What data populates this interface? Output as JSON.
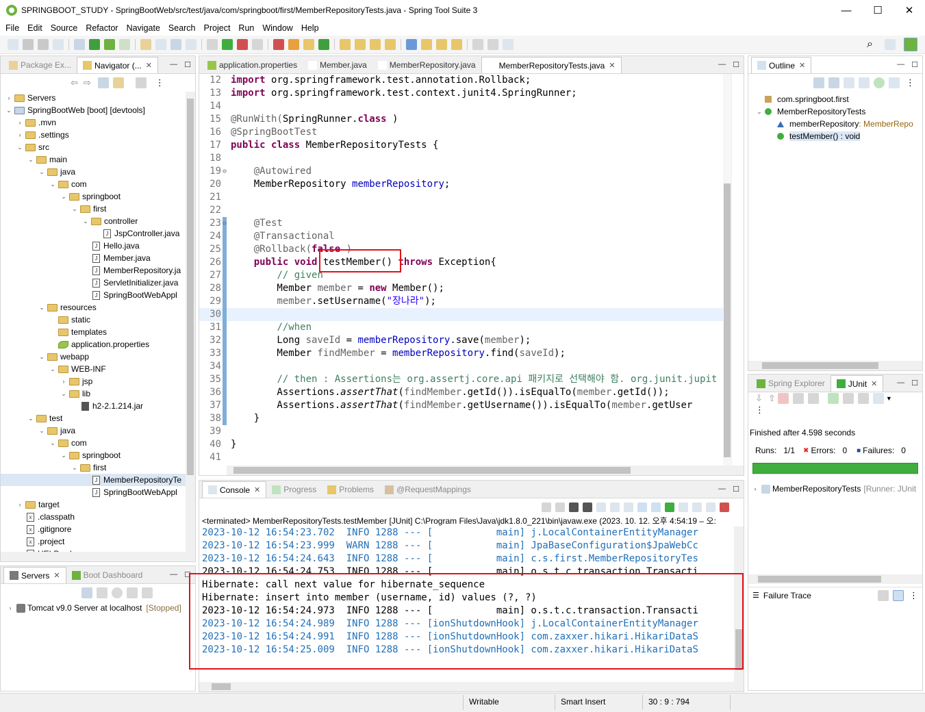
{
  "window": {
    "title": "SPRINGBOOT_STUDY - SpringBootWeb/src/test/java/com/springboot/first/MemberRepositoryTests.java - Spring Tool Suite 3",
    "minimize": "—",
    "maximize": "☐",
    "close": "✕"
  },
  "menu": [
    "File",
    "Edit",
    "Source",
    "Refactor",
    "Navigate",
    "Search",
    "Project",
    "Run",
    "Window",
    "Help"
  ],
  "explorer": {
    "tabs": [
      {
        "label": "Package Ex..."
      },
      {
        "label": "Navigator (..."
      }
    ],
    "rows": [
      {
        "d": 0,
        "t": "›",
        "k": "s",
        "label": "Servers"
      },
      {
        "d": 0,
        "t": "⌄",
        "k": "p",
        "label": "SpringBootWeb [boot] [devtools]"
      },
      {
        "d": 1,
        "t": "›",
        "k": "f",
        "label": ".mvn"
      },
      {
        "d": 1,
        "t": "›",
        "k": "f",
        "label": ".settings"
      },
      {
        "d": 1,
        "t": "⌄",
        "k": "f",
        "label": "src"
      },
      {
        "d": 2,
        "t": "⌄",
        "k": "f",
        "label": "main"
      },
      {
        "d": 3,
        "t": "⌄",
        "k": "f",
        "label": "java"
      },
      {
        "d": 4,
        "t": "⌄",
        "k": "f",
        "label": "com"
      },
      {
        "d": 5,
        "t": "⌄",
        "k": "f",
        "label": "springboot"
      },
      {
        "d": 6,
        "t": "⌄",
        "k": "f",
        "label": "first"
      },
      {
        "d": 7,
        "t": "⌄",
        "k": "f",
        "label": "controller"
      },
      {
        "d": 8,
        "t": "",
        "k": "j",
        "label": "JspController.java"
      },
      {
        "d": 7,
        "t": "",
        "k": "j",
        "label": "Hello.java"
      },
      {
        "d": 7,
        "t": "",
        "k": "j",
        "label": "Member.java"
      },
      {
        "d": 7,
        "t": "",
        "k": "j",
        "label": "MemberRepository.ja"
      },
      {
        "d": 7,
        "t": "",
        "k": "j",
        "label": "ServletInitializer.java"
      },
      {
        "d": 7,
        "t": "",
        "k": "j",
        "label": "SpringBootWebAppl"
      },
      {
        "d": 3,
        "t": "⌄",
        "k": "f",
        "label": "resources"
      },
      {
        "d": 4,
        "t": "",
        "k": "f",
        "label": "static"
      },
      {
        "d": 4,
        "t": "",
        "k": "f",
        "label": "templates"
      },
      {
        "d": 4,
        "t": "",
        "k": "l",
        "label": "application.properties"
      },
      {
        "d": 3,
        "t": "⌄",
        "k": "f",
        "label": "webapp"
      },
      {
        "d": 4,
        "t": "⌄",
        "k": "f",
        "label": "WEB-INF"
      },
      {
        "d": 5,
        "t": "›",
        "k": "f",
        "label": "jsp"
      },
      {
        "d": 5,
        "t": "⌄",
        "k": "f",
        "label": "lib"
      },
      {
        "d": 6,
        "t": "",
        "k": "r",
        "label": "h2-2.1.214.jar"
      },
      {
        "d": 2,
        "t": "⌄",
        "k": "f",
        "label": "test"
      },
      {
        "d": 3,
        "t": "⌄",
        "k": "f",
        "label": "java"
      },
      {
        "d": 4,
        "t": "⌄",
        "k": "f",
        "label": "com"
      },
      {
        "d": 5,
        "t": "⌄",
        "k": "f",
        "label": "springboot"
      },
      {
        "d": 6,
        "t": "⌄",
        "k": "f",
        "label": "first"
      },
      {
        "d": 7,
        "t": "",
        "k": "j",
        "label": "MemberRepositoryTe",
        "sel": true
      },
      {
        "d": 7,
        "t": "",
        "k": "j",
        "label": "SpringBootWebAppl"
      },
      {
        "d": 1,
        "t": "›",
        "k": "f",
        "label": "target"
      },
      {
        "d": 1,
        "t": "",
        "k": "x",
        "label": ".classpath"
      },
      {
        "d": 1,
        "t": "",
        "k": "x",
        "label": ".gitignore"
      },
      {
        "d": 1,
        "t": "",
        "k": "x",
        "label": ".project"
      },
      {
        "d": 1,
        "t": "",
        "k": "x",
        "label": "HELP.md"
      }
    ]
  },
  "servers": {
    "tabs": [
      {
        "label": "Servers"
      },
      {
        "label": "Boot Dashboard"
      }
    ],
    "item": "Tomcat v9.0 Server at localhost",
    "state": "[Stopped]"
  },
  "editor": {
    "tabs": [
      {
        "label": "application.properties"
      },
      {
        "label": "Member.java"
      },
      {
        "label": "MemberRepository.java"
      },
      {
        "label": "MemberRepositoryTests.java"
      }
    ],
    "lines": [
      {
        "n": "12",
        "s": [
          [
            "kw",
            "import"
          ],
          [
            "",
            "org.springframework.test.annotation.Rollback;"
          ]
        ],
        "sep": true
      },
      {
        "n": "13",
        "s": [
          [
            "kw",
            "import"
          ],
          [
            "",
            "org.springframework.test.context.junit4.SpringRunner;"
          ]
        ],
        "sep": true
      },
      {
        "n": "14",
        "s": []
      },
      {
        "n": "15",
        "s": [
          [
            "an",
            "@RunWith("
          ],
          [
            "",
            "SpringRunner."
          ],
          [
            "kw",
            "class"
          ],
          [
            "",
            ")"
          ]
        ]
      },
      {
        "n": "16",
        "s": [
          [
            "an",
            "@SpringBootTest"
          ]
        ]
      },
      {
        "n": "17",
        "s": [
          [
            "kw",
            "public class"
          ],
          [
            "",
            "MemberRepositoryTests {"
          ]
        ],
        "sep": true
      },
      {
        "n": "18",
        "s": []
      },
      {
        "n": "19",
        "s": [
          [
            "",
            "    "
          ],
          [
            "an",
            "@Autowired"
          ]
        ],
        "fold": true
      },
      {
        "n": "20",
        "s": [
          [
            "",
            "    MemberRepository "
          ],
          [
            "fd",
            "memberRepository"
          ],
          [
            "",
            ";"
          ]
        ]
      },
      {
        "n": "21",
        "s": []
      },
      {
        "n": "22",
        "s": []
      },
      {
        "n": "23",
        "s": [
          [
            "",
            "    "
          ],
          [
            "an",
            "@Test"
          ]
        ],
        "fold": true,
        "mark": true
      },
      {
        "n": "24",
        "s": [
          [
            "",
            "    "
          ],
          [
            "an",
            "@Transactional"
          ]
        ],
        "mark": true
      },
      {
        "n": "25",
        "s": [
          [
            "",
            "    "
          ],
          [
            "an",
            "@Rollback("
          ],
          [
            "kw",
            "false"
          ],
          [
            "an",
            ")"
          ]
        ],
        "mark": true
      },
      {
        "n": "26",
        "s": [
          [
            "",
            "    "
          ],
          [
            "kw",
            "public void"
          ],
          [
            "",
            " testMember() "
          ],
          [
            "kw",
            "throws"
          ],
          [
            "",
            " Exception{"
          ]
        ],
        "mark": true
      },
      {
        "n": "27",
        "s": [
          [
            "",
            "        "
          ],
          [
            "cm",
            "// given"
          ]
        ],
        "mark": true
      },
      {
        "n": "28",
        "s": [
          [
            "",
            "        Member "
          ],
          [
            "an",
            "member"
          ],
          [
            "",
            " = "
          ],
          [
            "kw",
            "new"
          ],
          [
            "",
            " Member();"
          ]
        ],
        "mark": true
      },
      {
        "n": "29",
        "s": [
          [
            "",
            "        "
          ],
          [
            "an",
            "member"
          ],
          [
            "",
            ".setUsername("
          ],
          [
            "st",
            "\"장나라\""
          ],
          [
            "",
            ");"
          ]
        ],
        "mark": true
      },
      {
        "n": "30",
        "s": [],
        "cur": true,
        "mark": true
      },
      {
        "n": "31",
        "s": [
          [
            "",
            "        "
          ],
          [
            "cm",
            "//when"
          ]
        ],
        "mark": true
      },
      {
        "n": "32",
        "s": [
          [
            "",
            "        Long "
          ],
          [
            "an",
            "saveId"
          ],
          [
            "",
            " = "
          ],
          [
            "fd",
            "memberRepository"
          ],
          [
            "",
            ".save("
          ],
          [
            "an",
            "member"
          ],
          [
            "",
            ");"
          ]
        ],
        "mark": true
      },
      {
        "n": "33",
        "s": [
          [
            "",
            "        Member "
          ],
          [
            "an",
            "findMember"
          ],
          [
            "",
            " = "
          ],
          [
            "fd",
            "memberRepository"
          ],
          [
            "",
            ".find("
          ],
          [
            "an",
            "saveId"
          ],
          [
            "",
            ");"
          ]
        ],
        "mark": true
      },
      {
        "n": "34",
        "s": [],
        "mark": true
      },
      {
        "n": "35",
        "s": [
          [
            "",
            "        "
          ],
          [
            "cm",
            "// then : Assertions는 org.assertj.core.api 패키지로 선택해야 함. org.junit.jupit"
          ]
        ],
        "mark": true
      },
      {
        "n": "36",
        "s": [
          [
            "",
            "        Assertions."
          ],
          [
            "it",
            "assertThat"
          ],
          [
            "",
            "("
          ],
          [
            "an",
            "findMember"
          ],
          [
            "",
            ".getId()).isEqualTo("
          ],
          [
            "an",
            "member"
          ],
          [
            "",
            ".getId());"
          ]
        ],
        "mark": true
      },
      {
        "n": "37",
        "s": [
          [
            "",
            "        Assertions."
          ],
          [
            "it",
            "assertThat"
          ],
          [
            "",
            "("
          ],
          [
            "an",
            "findMember"
          ],
          [
            "",
            ".getUsername()).isEqualTo("
          ],
          [
            "an",
            "member"
          ],
          [
            "",
            ".getUser"
          ]
        ],
        "mark": true
      },
      {
        "n": "38",
        "s": [
          [
            "",
            "    }"
          ]
        ],
        "mark": true
      },
      {
        "n": "39",
        "s": []
      },
      {
        "n": "40",
        "s": [
          [
            "",
            "}"
          ]
        ]
      },
      {
        "n": "41",
        "s": []
      }
    ]
  },
  "outline": {
    "tab": "Outline",
    "rows": [
      {
        "label": "com.springboot.first",
        "d": 0,
        "k": "pkg"
      },
      {
        "label": "MemberRepositoryTests",
        "d": 0,
        "k": "cls",
        "t": "⌄"
      },
      {
        "label": "memberRepository",
        "type": " : MemberRepo",
        "d": 1,
        "k": "fld"
      },
      {
        "label": "testMember() : void",
        "d": 1,
        "k": "mth",
        "sel": true
      }
    ]
  },
  "junit": {
    "tabs": [
      {
        "label": "Spring Explorer"
      },
      {
        "label": "JUnit"
      }
    ],
    "finished": "Finished after 4.598 seconds",
    "runs_label": "Runs:",
    "runs": "1/1",
    "errors_label": "Errors:",
    "errors": "0",
    "failures_label": "Failures:",
    "failures": "0",
    "progress": 1.0,
    "test": "MemberRepositoryTests",
    "runner": "[Runner: JUnit",
    "trace": "Failure Trace"
  },
  "console": {
    "tabs": [
      {
        "label": "Console"
      },
      {
        "label": "Progress"
      },
      {
        "label": "Problems"
      },
      {
        "label": "@RequestMappings"
      }
    ],
    "header": "<terminated> MemberRepositoryTests.testMember [JUnit] C:\\Program Files\\Java\\jdk1.8.0_221\\bin\\javaw.exe  (2023. 10. 12. 오후 4:54:19 – 오:",
    "lines": [
      {
        "c": "blue",
        "t": "2023-10-12 16:54:23.702  INFO 1288 --- [           main] j.LocalContainerEntityManager"
      },
      {
        "c": "blue",
        "t": "2023-10-12 16:54:23.999  WARN 1288 --- [           main] JpaBaseConfiguration$JpaWebCc"
      },
      {
        "c": "blue",
        "t": "2023-10-12 16:54:24.643  INFO 1288 --- [           main] c.s.first.MemberRepositoryTes"
      },
      {
        "c": "",
        "t": "2023-10-12 16:54:24.753  INFO 1288 --- [           main] o.s.t.c.transaction.Transacti"
      },
      {
        "c": "",
        "t": "Hibernate: call next value for hibernate_sequence"
      },
      {
        "c": "",
        "t": "Hibernate: insert into member (username, id) values (?, ?)"
      },
      {
        "c": "",
        "t": "2023-10-12 16:54:24.973  INFO 1288 --- [           main] o.s.t.c.transaction.Transacti"
      },
      {
        "c": "blue",
        "t": "2023-10-12 16:54:24.989  INFO 1288 --- [ionShutdownHook] j.LocalContainerEntityManager"
      },
      {
        "c": "blue",
        "t": "2023-10-12 16:54:24.991  INFO 1288 --- [ionShutdownHook] com.zaxxer.hikari.HikariDataS"
      },
      {
        "c": "blue",
        "t": "2023-10-12 16:54:25.009  INFO 1288 --- [ionShutdownHook] com.zaxxer.hikari.HikariDataS"
      }
    ]
  },
  "status": {
    "writable": "Writable",
    "insert": "Smart Insert",
    "pos": "30 : 9 : 794"
  },
  "colors": {
    "keyword": "#7f0055",
    "annotation": "#646464",
    "field": "#0000c0",
    "comment": "#3f7f5f",
    "string": "#2a00ff",
    "highlight": "#e0121a",
    "junit_bar": "#3fae3f"
  }
}
